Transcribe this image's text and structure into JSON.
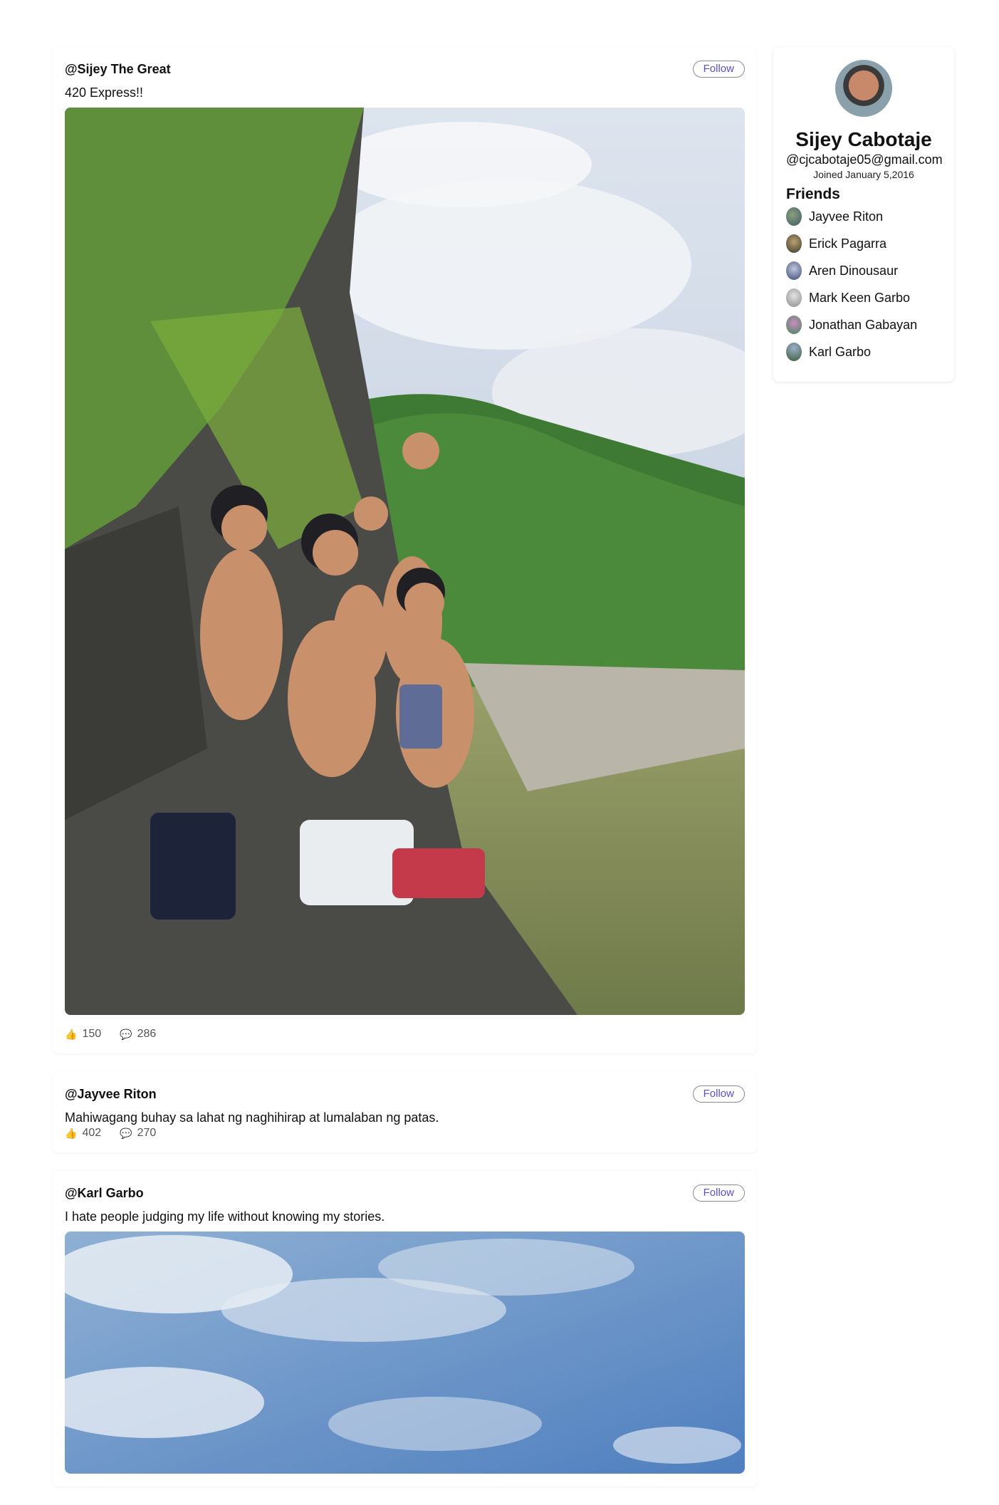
{
  "posts": [
    {
      "username": "@Sijey The Great",
      "follow_label": "Follow",
      "text": "420 Express!!",
      "likes": "150",
      "comments": "286",
      "image": "group-photo-river-mountain"
    },
    {
      "username": "@Jayvee Riton",
      "follow_label": "Follow",
      "text": "Mahiwagang buhay sa lahat ng naghihirap at lumalaban ng patas.",
      "likes": "402",
      "comments": "270"
    },
    {
      "username": "@Karl Garbo",
      "follow_label": "Follow",
      "text": "I hate people judging my life without knowing my stories.",
      "image": "blue-sky-clouds"
    }
  ],
  "profile": {
    "name": "Sijey Cabotaje",
    "email": "@cjcabotaje05@gmail.com",
    "joined": "Joined January 5,2016",
    "friends_title": "Friends",
    "friends": [
      {
        "name": "Jayvee Riton"
      },
      {
        "name": "Erick Pagarra"
      },
      {
        "name": "Aren Dinousaur"
      },
      {
        "name": "Mark Keen Garbo"
      },
      {
        "name": "Jonathan Gabayan"
      },
      {
        "name": "Karl Garbo"
      }
    ]
  },
  "icons": {
    "like": "thumbs-up-icon",
    "comment": "speech-bubble-icon"
  },
  "colors": {
    "follow_text": "#5a4fcf",
    "like_icon": "#e8a52b",
    "comment_icon": "#b9bde8"
  }
}
